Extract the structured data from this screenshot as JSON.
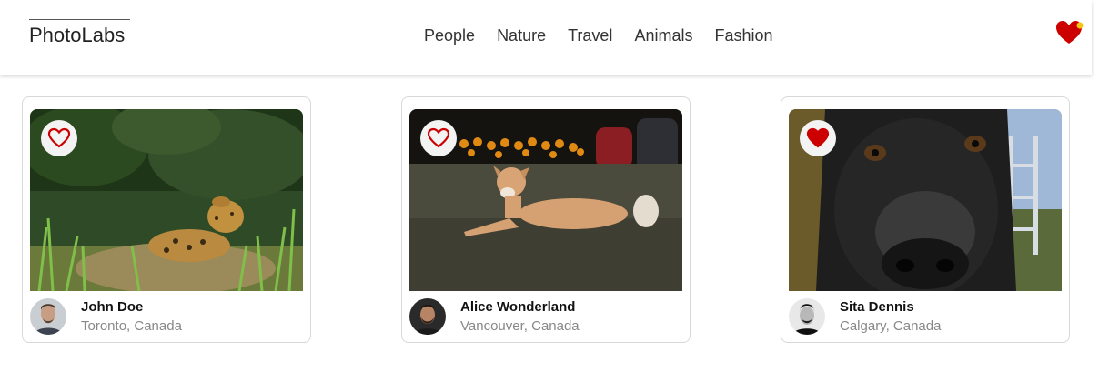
{
  "app": {
    "logo": "PhotoLabs"
  },
  "nav": {
    "items": [
      "People",
      "Nature",
      "Travel",
      "Animals",
      "Fashion"
    ]
  },
  "header": {
    "favorites_icon": "heart-icon",
    "notification_dot_color": "#f5c518",
    "accent_color": "#cc0000"
  },
  "photos": [
    {
      "user_name": "John Doe",
      "location": "Toronto, Canada",
      "liked": false,
      "subject": "jaguar"
    },
    {
      "user_name": "Alice Wonderland",
      "location": "Vancouver, Canada",
      "liked": false,
      "subject": "dog-lying"
    },
    {
      "user_name": "Sita Dennis",
      "location": "Calgary, Canada",
      "liked": true,
      "subject": "dog-closeup"
    }
  ]
}
